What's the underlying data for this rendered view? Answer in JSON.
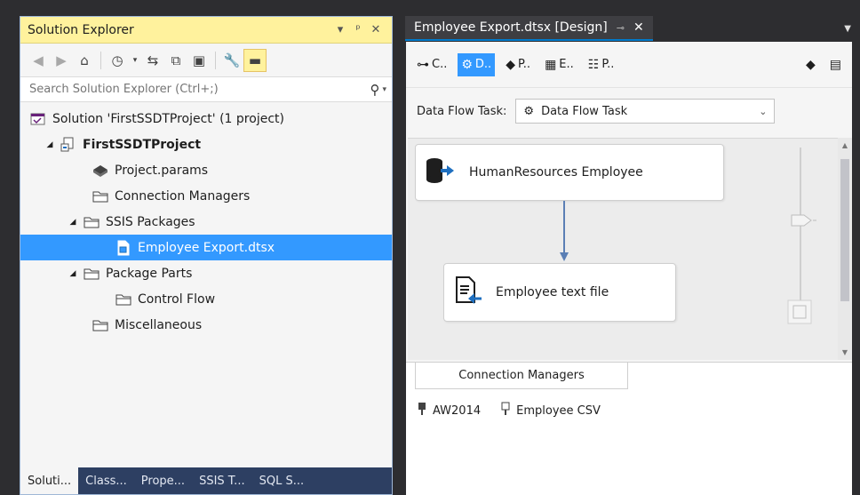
{
  "solution_explorer": {
    "title": "Solution Explorer",
    "search_placeholder": "Search Solution Explorer (Ctrl+;)",
    "tree": {
      "solution": "Solution 'FirstSSDTProject' (1 project)",
      "project": "FirstSSDTProject",
      "project_params": "Project.params",
      "connection_managers": "Connection Managers",
      "ssis_packages": "SSIS Packages",
      "package_file": "Employee Export.dtsx",
      "package_parts": "Package Parts",
      "control_flow": "Control Flow",
      "miscellaneous": "Miscellaneous"
    },
    "bottom_tabs": [
      "Soluti...",
      "Class...",
      "Prope...",
      "SSIS T...",
      "SQL S..."
    ]
  },
  "designer": {
    "doc_tab_title": "Employee Export.dtsx [Design]",
    "tabs": [
      "C..",
      "D..",
      "P..",
      "E..",
      "P.."
    ],
    "data_flow_task_label": "Data Flow Task:",
    "data_flow_task_value": "Data Flow Task",
    "components": {
      "source": "HumanResources Employee",
      "destination": "Employee text file"
    },
    "connection_managers_tab": "Connection Managers",
    "connections": [
      "AW2014",
      "Employee CSV"
    ]
  },
  "colors": {
    "accent_yellow": "#fff29d",
    "selection_blue": "#3399ff",
    "ide_dark": "#2d2d30",
    "tab_strip_blue": "#2d3f62",
    "connector_blue": "#5b7fb5"
  }
}
